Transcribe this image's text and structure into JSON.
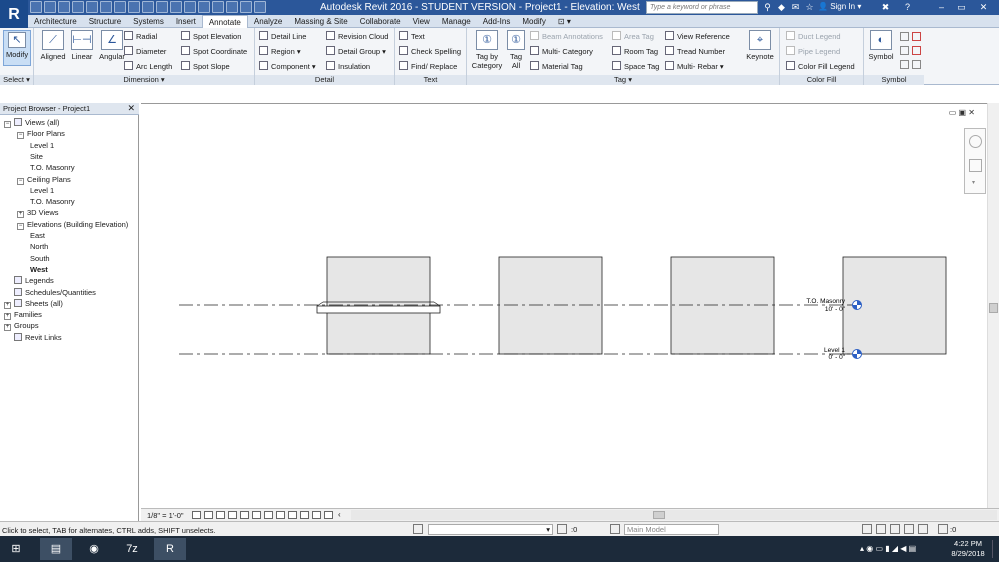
{
  "app": {
    "title": "Autodesk Revit 2016 - STUDENT VERSION -    Project1 - Elevation: West",
    "search_placeholder": "Type a keyword or phrase",
    "sign_in": "Sign In",
    "logo": "R",
    "help": "?"
  },
  "tabs": [
    "Architecture",
    "Structure",
    "Systems",
    "Insert",
    "Annotate",
    "Analyze",
    "Massing & Site",
    "Collaborate",
    "View",
    "Manage",
    "Add-Ins",
    "Modify"
  ],
  "active_tab": "Annotate",
  "ribbon": {
    "select": {
      "modify": "Modify",
      "label": "Select ▾"
    },
    "dimension": {
      "aligned": "Aligned",
      "linear": "Linear",
      "angular": "Angular",
      "radial": "Radial",
      "diameter": "Diameter",
      "arc_length": "Arc  Length",
      "spot_elevation": "Spot  Elevation",
      "spot_coordinate": "Spot  Coordinate",
      "spot_slope": "Spot  Slope",
      "label": "Dimension  ▾"
    },
    "detail": {
      "detail_line": "Detail  Line",
      "region": "Region  ▾",
      "component": "Component  ▾",
      "revision_cloud": "Revision  Cloud",
      "detail_group": "Detail  Group  ▾",
      "insulation": "Insulation",
      "label": "Detail"
    },
    "text": {
      "text": "Text",
      "check_spelling": "Check  Spelling",
      "find_replace": "Find/  Replace",
      "label": "Text"
    },
    "tag": {
      "tag_by_category": "Tag by Category",
      "tag_all": "Tag All",
      "beam_annotations": "Beam  Annotations",
      "multi_category": "Multi-  Category",
      "material_tag": "Material  Tag",
      "area_tag": "Area  Tag",
      "room_tag": "Room  Tag",
      "space_tag": "Space  Tag",
      "view_reference": "View  Reference",
      "tread_number": "Tread  Number",
      "multi_rebar": "Multi-  Rebar  ▾",
      "keynote": "Keynote",
      "label": "Tag  ▾"
    },
    "color_fill": {
      "duct_legend": "Duct  Legend",
      "pipe_legend": "Pipe  Legend",
      "color_fill_legend": "Color Fill  Legend",
      "label": "Color Fill"
    },
    "symbol": {
      "symbol": "Symbol",
      "label": "Symbol"
    }
  },
  "project_browser": {
    "title": "Project Browser - Project1",
    "close": "✕",
    "items": [
      {
        "label": "Views (all)",
        "level": 0,
        "toggle": "−",
        "icon": true
      },
      {
        "label": "Floor Plans",
        "level": 1,
        "toggle": "−"
      },
      {
        "label": "Level 1",
        "level": 2
      },
      {
        "label": "Site",
        "level": 2
      },
      {
        "label": "T.O. Masonry",
        "level": 2
      },
      {
        "label": "Ceiling Plans",
        "level": 1,
        "toggle": "−"
      },
      {
        "label": "Level 1",
        "level": 2
      },
      {
        "label": "T.O. Masonry",
        "level": 2
      },
      {
        "label": "3D Views",
        "level": 1,
        "toggle": "+"
      },
      {
        "label": "Elevations (Building Elevation)",
        "level": 1,
        "toggle": "−"
      },
      {
        "label": "East",
        "level": 2
      },
      {
        "label": "North",
        "level": 2
      },
      {
        "label": "South",
        "level": 2
      },
      {
        "label": "West",
        "level": 2,
        "bold": true
      },
      {
        "label": "Legends",
        "level": 0,
        "icon": true
      },
      {
        "label": "Schedules/Quantities",
        "level": 0,
        "icon": true
      },
      {
        "label": "Sheets (all)",
        "level": 0,
        "toggle": "+",
        "icon": true
      },
      {
        "label": "Families",
        "level": 0,
        "toggle": "+"
      },
      {
        "label": "Groups",
        "level": 0,
        "toggle": "+"
      },
      {
        "label": "Revit Links",
        "level": 0,
        "icon": true
      }
    ]
  },
  "canvas": {
    "levels": [
      {
        "name": "T.O. Masonry",
        "elevation": "10' - 0\""
      },
      {
        "name": "Level 1",
        "elevation": "0' - 0\""
      }
    ],
    "window_controls": "▭ ▣ ✕"
  },
  "view_control": {
    "scale": "1/8\" = 1'-0\""
  },
  "status_bar": {
    "text": "Click to select, TAB for alternates, CTRL adds, SHIFT unselects.",
    "worksets_count": ":0",
    "design_option": "Main Model",
    "filter_count": ":0"
  },
  "clock": {
    "time": "4:22 PM",
    "date": "8/29/2018"
  },
  "colors": {
    "title_bar": "#2b579a",
    "wall_fill": "#e6e6e6",
    "level_head": "#2c5fc4"
  }
}
